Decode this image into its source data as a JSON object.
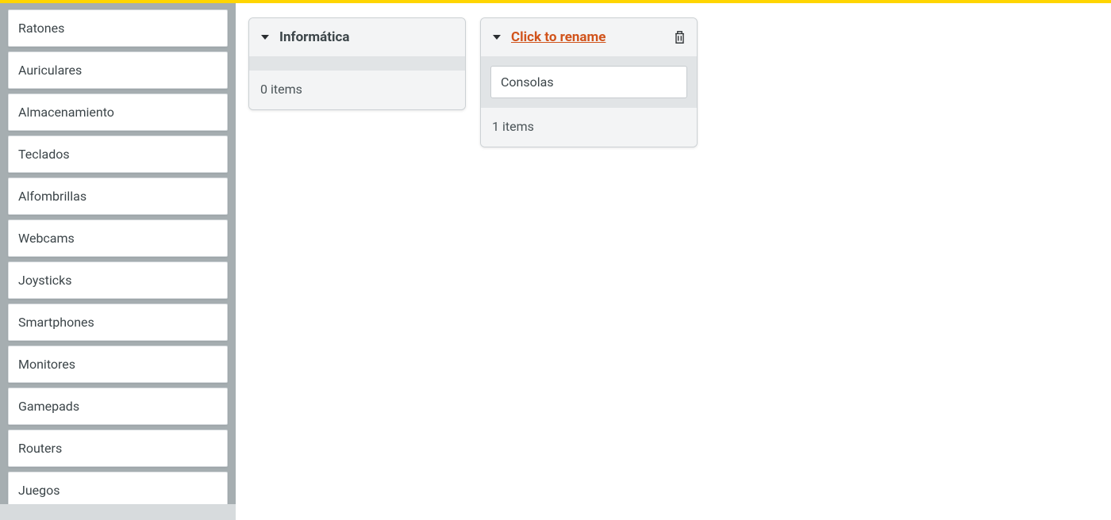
{
  "sidebar": {
    "items": [
      {
        "label": "Ratones"
      },
      {
        "label": "Auriculares"
      },
      {
        "label": "Almacenamiento"
      },
      {
        "label": "Teclados"
      },
      {
        "label": "Alfombrillas"
      },
      {
        "label": "Webcams"
      },
      {
        "label": "Joysticks"
      },
      {
        "label": "Smartphones"
      },
      {
        "label": "Monitores"
      },
      {
        "label": "Gamepads"
      },
      {
        "label": "Routers"
      },
      {
        "label": "Juegos"
      }
    ]
  },
  "cards": [
    {
      "title": "Informática",
      "rename_mode": false,
      "items": [],
      "count_text": "0 items"
    },
    {
      "title": "Click to rename",
      "rename_mode": true,
      "items": [
        {
          "label": "Consolas"
        }
      ],
      "count_text": "1 items"
    }
  ]
}
